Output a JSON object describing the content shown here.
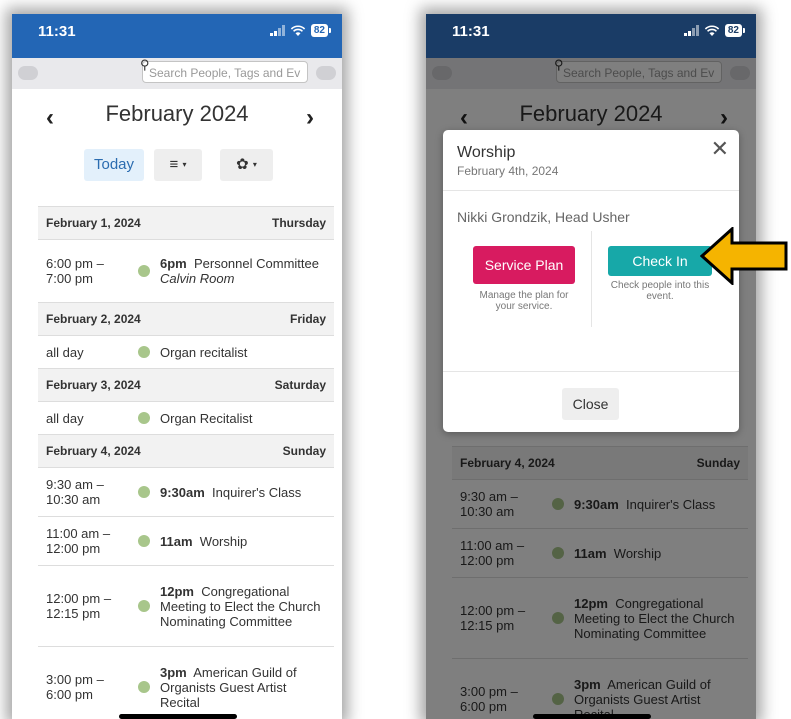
{
  "status": {
    "time": "11:31",
    "battery": "82"
  },
  "search": {
    "placeholder": "Search People, Tags and Ev"
  },
  "calendar": {
    "month": "February 2024",
    "prev": "‹",
    "next": "›",
    "today_label": "Today",
    "list_icon": "≡",
    "gear_icon": "✿",
    "caret": "▾"
  },
  "agenda_left": [
    {
      "date": "February 1, 2024",
      "weekday": "Thursday",
      "events": [
        {
          "time": "6:00 pm – 7:00 pm",
          "bold": "6pm",
          "title": "Personnel Committee",
          "location": "Calvin Room"
        }
      ]
    },
    {
      "date": "February 2, 2024",
      "weekday": "Friday",
      "events": [
        {
          "time": "all day",
          "bold": "",
          "title": "Organ recitalist",
          "location": ""
        }
      ]
    },
    {
      "date": "February 3, 2024",
      "weekday": "Saturday",
      "events": [
        {
          "time": "all day",
          "bold": "",
          "title": "Organ Recitalist",
          "location": ""
        }
      ]
    },
    {
      "date": "February 4, 2024",
      "weekday": "Sunday",
      "events": [
        {
          "time": "9:30 am – 10:30 am",
          "bold": "9:30am",
          "title": "Inquirer's Class",
          "location": ""
        },
        {
          "time": "11:00 am – 12:00 pm",
          "bold": "11am",
          "title": "Worship",
          "location": ""
        },
        {
          "time": "12:00 pm – 12:15 pm",
          "bold": "12pm",
          "title": "Congregational Meeting to Elect the Church Nominating Committee",
          "location": ""
        },
        {
          "time": "3:00 pm – 6:00 pm",
          "bold": "3pm",
          "title": "American Guild of Organists Guest Artist Recital",
          "location": ""
        }
      ]
    }
  ],
  "agenda_right": [
    {
      "date": "February 4, 2024",
      "weekday": "Sunday",
      "events": [
        {
          "time": "9:30 am – 10:30 am",
          "bold": "9:30am",
          "title": "Inquirer's Class",
          "location": ""
        },
        {
          "time": "11:00 am – 12:00 pm",
          "bold": "11am",
          "title": "Worship",
          "location": ""
        },
        {
          "time": "12:00 pm – 12:15 pm",
          "bold": "12pm",
          "title": "Congregational Meeting to Elect the Church Nominating Committee",
          "location": ""
        },
        {
          "time": "3:00 pm – 6:00 pm",
          "bold": "3pm",
          "title": "American Guild of Organists Guest Artist Recital",
          "location": ""
        }
      ]
    }
  ],
  "modal": {
    "title": "Worship",
    "date": "February 4th, 2024",
    "leader": "Nikki Grondzik, Head Usher",
    "service_plan_label": "Service Plan",
    "service_plan_help": "Manage the plan for your service.",
    "check_in_label": "Check In",
    "check_in_help": "Check people into this event.",
    "close_label": "Close",
    "close_icon": "✕"
  },
  "colors": {
    "header_blue": "#2366b5",
    "service_plan": "#d81b60",
    "check_in": "#17a8a8",
    "event_dot": "#a8c68b",
    "arrow_fill": "#f5b400"
  },
  "icons": [
    "search-icon",
    "wifi-icon",
    "signal-icon",
    "battery-icon",
    "list-icon",
    "gear-icon",
    "close-icon",
    "arrow-pointer-icon"
  ]
}
